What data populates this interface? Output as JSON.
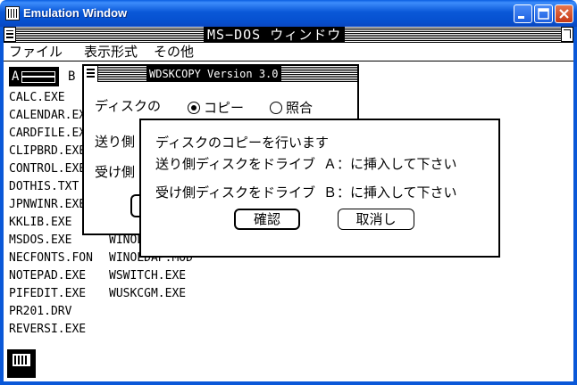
{
  "window": {
    "title": "Emulation Window"
  },
  "dos": {
    "title": "MS−DOS ウィンドウ",
    "menu": [
      "ファイル",
      "表示形式",
      "その他"
    ]
  },
  "drives": {
    "a": "A",
    "b": "B"
  },
  "files": {
    "col1": [
      "CALC.EXE",
      "CALENDAR.EXE",
      "CARDFILE.EXE",
      "CLIPBRD.EXE",
      "CONTROL.EXE",
      "DOTHIS.TXT",
      "JPNWINR.EXE",
      "KKLIB.EXE",
      "MSDOS.EXE",
      "NECFONTS.FON",
      "NOTEPAD.EXE",
      "PIFEDIT.EXE",
      "PR201.DRV",
      "REVERSI.EXE"
    ],
    "col2": [
      "WINOLDAP.GRB",
      "WINOLDAP.MOD",
      "WSWITCH.EXE",
      "WUSKCGM.EXE"
    ]
  },
  "wdskcopy": {
    "title": "WDSKCOPY Version 3.0",
    "disk_label": "ディスクの",
    "radio_copy": "コピー",
    "radio_compare": "照合",
    "send_label": "送り側",
    "recv_label": "受け側"
  },
  "message": {
    "line1": "ディスクのコピーを行います",
    "line2": "送り側ディスクをドライブ Ａ：に挿入して下さい",
    "line3": "受け側ディスクをドライブ Ｂ：に挿入して下さい",
    "ok": "確認",
    "cancel": "取消し"
  }
}
